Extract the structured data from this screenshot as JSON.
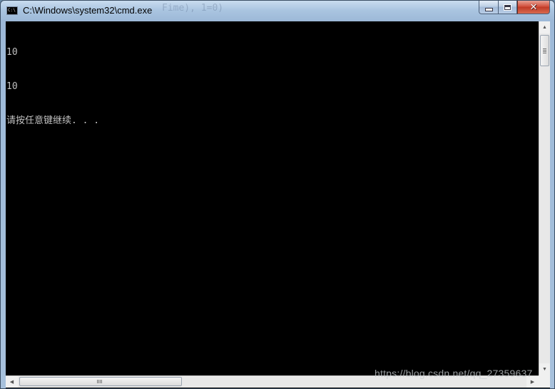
{
  "window": {
    "title": "C:\\Windows\\system32\\cmd.exe",
    "background_ghost_text": "Fime), 1=0)",
    "icon_label": "C:\\"
  },
  "caption_buttons": {
    "minimize_icon": "minimize-icon",
    "maximize_icon": "maximize-icon",
    "close_icon": "close-icon",
    "close_glyph": "✕"
  },
  "console": {
    "lines": [
      "10",
      "10",
      "请按任意键继续. . ."
    ],
    "background": "#000000",
    "foreground": "#c0c0c0"
  },
  "scrollbars": {
    "up_arrow": "▲",
    "down_arrow": "▼",
    "left_arrow": "◀",
    "right_arrow": "▶"
  },
  "watermark": "https://blog.csdn.net/qq_27359637"
}
